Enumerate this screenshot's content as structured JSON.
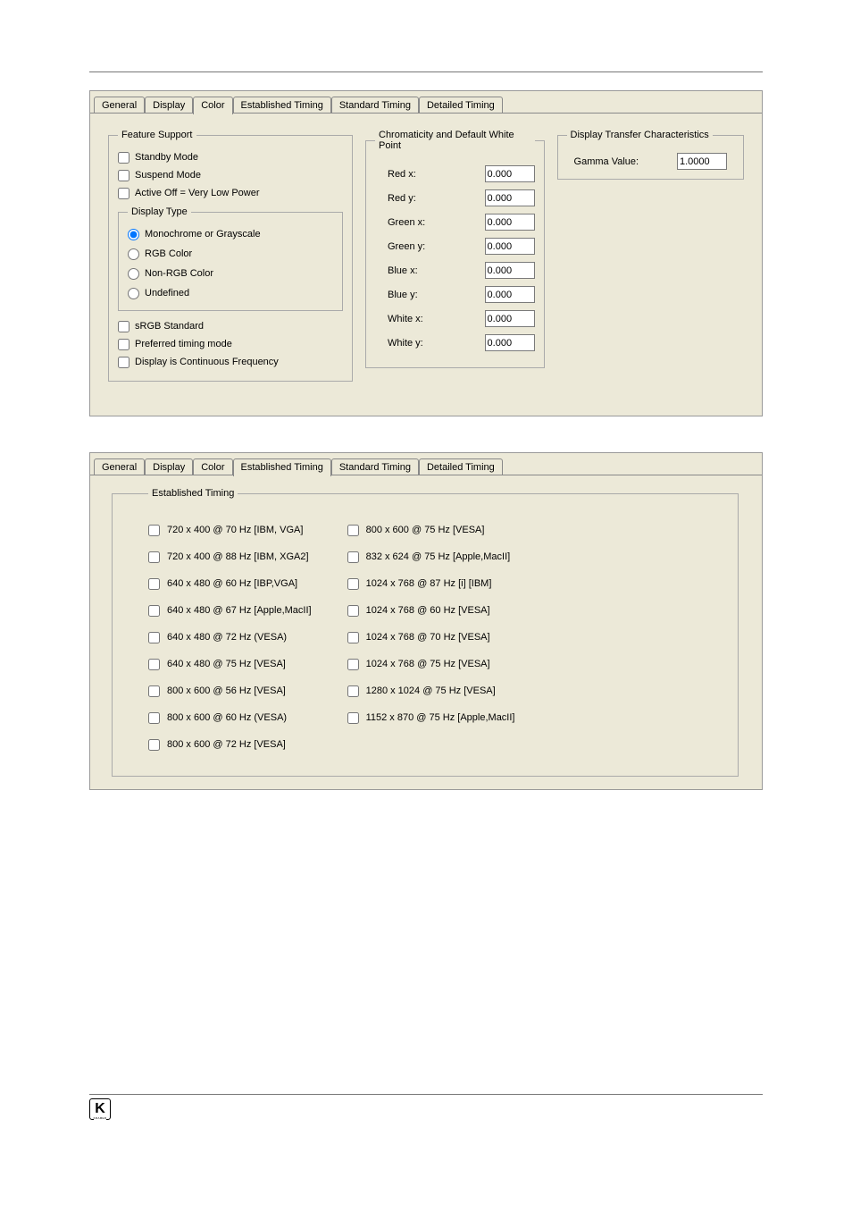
{
  "tabs": {
    "general": "General",
    "display": "Display",
    "color": "Color",
    "established": "Established Timing",
    "standard": "Standard Timing",
    "detailed": "Detailed Timing"
  },
  "feature_support": {
    "legend": "Feature Support",
    "standby": "Standby Mode",
    "suspend": "Suspend Mode",
    "activeoff": "Active Off = Very Low Power",
    "srgb": "sRGB Standard",
    "preferred": "Preferred timing mode",
    "continuous": "Display is Continuous Frequency"
  },
  "display_type": {
    "legend": "Display Type",
    "mono": "Monochrome or Grayscale",
    "rgb": "RGB Color",
    "nonrgb": "Non-RGB Color",
    "undefined": "Undefined"
  },
  "chrom": {
    "legend": "Chromaticity and Default White Point",
    "redx_l": "Red x:",
    "redx_v": "0.000",
    "redy_l": "Red y:",
    "redy_v": "0.000",
    "grnx_l": "Green x:",
    "grnx_v": "0.000",
    "grny_l": "Green y:",
    "grny_v": "0.000",
    "blux_l": "Blue x:",
    "blux_v": "0.000",
    "bluy_l": "Blue y:",
    "bluy_v": "0.000",
    "whtx_l": "White x:",
    "whtx_v": "0.000",
    "whty_l": "White y:",
    "whty_v": "0.000"
  },
  "dtc": {
    "legend": "Display Transfer Characteristics",
    "gamma_l": "Gamma Value:",
    "gamma_v": "1.0000"
  },
  "est": {
    "legend": "Established Timing",
    "left": [
      "720 x 400 @ 70 Hz [IBM, VGA]",
      "720 x 400 @ 88 Hz [IBM, XGA2]",
      "640 x 480 @ 60 Hz [IBP,VGA]",
      "640 x 480 @ 67 Hz [Apple,MacII]",
      "640 x 480 @ 72 Hz (VESA)",
      "640 x 480 @ 75 Hz [VESA]",
      "800 x 600 @ 56 Hz [VESA]",
      "800 x 600 @ 60 Hz (VESA)",
      "800 x 600 @ 72 Hz [VESA]"
    ],
    "right": [
      "800 x 600 @ 75 Hz [VESA]",
      "832 x 624 @ 75 Hz [Apple,MacII]",
      "1024 x 768 @ 87 Hz [i] [IBM]",
      "1024 x 768 @ 60 Hz [VESA]",
      "1024 x 768 @ 70 Hz [VESA]",
      "1024 x 768 @ 75 Hz [VESA]",
      "1280 x 1024 @ 75 Hz [VESA]",
      "1152 x 870 @ 75 Hz [Apple,MacII]"
    ]
  },
  "logo_brand": "KRAMER"
}
